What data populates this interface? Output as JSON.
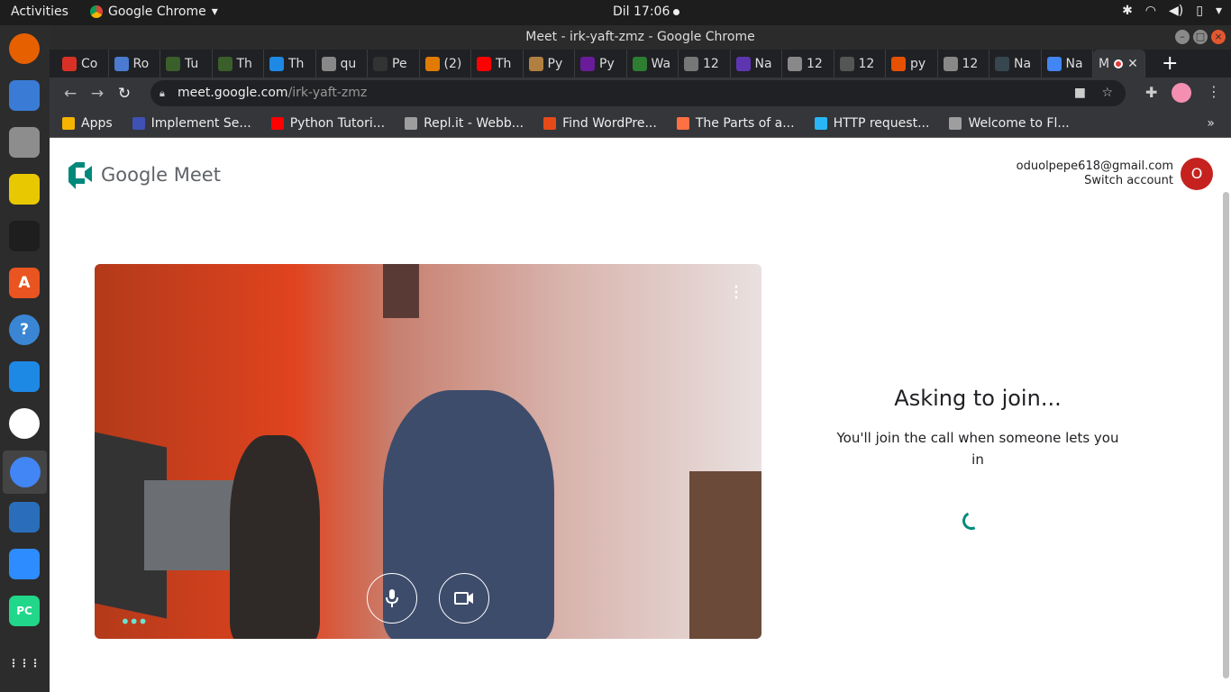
{
  "topbar": {
    "activities": "Activities",
    "app_name": "Google Chrome",
    "clock": "Dil 17:06"
  },
  "window": {
    "title": "Meet - irk-yaft-zmz - Google Chrome"
  },
  "tabs": [
    {
      "label": "Co",
      "color": "#d93025"
    },
    {
      "label": "Ro",
      "color": "#4a7bd0"
    },
    {
      "label": "Tu",
      "color": "#3a5f2a"
    },
    {
      "label": "Th",
      "color": "#3a5f2a"
    },
    {
      "label": "Th",
      "color": "#1e88e5"
    },
    {
      "label": "qu",
      "color": "#888888"
    },
    {
      "label": "Pe",
      "color": "#333333"
    },
    {
      "label": "(2)",
      "color": "#e07b00"
    },
    {
      "label": "Th",
      "color": "#ff0000"
    },
    {
      "label": "Py",
      "color": "#b08040"
    },
    {
      "label": "Py",
      "color": "#6a1b9a"
    },
    {
      "label": "Wa",
      "color": "#2e7d32"
    },
    {
      "label": "12",
      "color": "#777777"
    },
    {
      "label": "Na",
      "color": "#5e35b1"
    },
    {
      "label": "12",
      "color": "#888888"
    },
    {
      "label": "12",
      "color": "#555555"
    },
    {
      "label": "py",
      "color": "#e65100"
    },
    {
      "label": "12",
      "color": "#888888"
    },
    {
      "label": "Na",
      "color": "#37474f"
    },
    {
      "label": "Na",
      "color": "#4285f4"
    }
  ],
  "active_tab": {
    "label": "M"
  },
  "address": {
    "domain": "meet.google.com",
    "path": "/irk-yaft-zmz"
  },
  "bookmarks": [
    {
      "label": "Apps",
      "color": "#f4b400"
    },
    {
      "label": "Implement Se...",
      "color": "#3f51b5"
    },
    {
      "label": "Python Tutori...",
      "color": "#ff0000"
    },
    {
      "label": "Repl.it - Webb...",
      "color": "#9e9e9e"
    },
    {
      "label": "Find WordPre...",
      "color": "#e64a19"
    },
    {
      "label": "The Parts of a...",
      "color": "#ff7043"
    },
    {
      "label": "HTTP request...",
      "color": "#29b6f6"
    },
    {
      "label": "Welcome to Fl...",
      "color": "#9e9e9e"
    }
  ],
  "meet": {
    "logo_text": "Google Meet",
    "email": "oduolpepe618@gmail.com",
    "switch": "Switch account",
    "avatar_letter": "O",
    "asking": "Asking to join...",
    "message": "You'll join the call when someone lets you in"
  },
  "dock": [
    {
      "name": "firefox-icon",
      "color": "#e66000",
      "glyph": ""
    },
    {
      "name": "thunderbird-icon",
      "color": "#3a7bd5",
      "glyph": ""
    },
    {
      "name": "files-icon",
      "color": "#8d8d8d",
      "glyph": ""
    },
    {
      "name": "rhythmbox-icon",
      "color": "#e8c800",
      "glyph": ""
    },
    {
      "name": "figma-icon",
      "color": "#1e1e1e",
      "glyph": ""
    },
    {
      "name": "software-icon",
      "color": "#e95420",
      "glyph": "A"
    },
    {
      "name": "help-icon",
      "color": "#3a86d4",
      "glyph": "?"
    },
    {
      "name": "vscode-icon",
      "color": "#1e88e5",
      "glyph": ""
    },
    {
      "name": "slack-icon",
      "color": "#ffffff",
      "glyph": ""
    },
    {
      "name": "chrome-icon",
      "color": "#4285f4",
      "glyph": ""
    },
    {
      "name": "writer-icon",
      "color": "#2a6ebb",
      "glyph": ""
    },
    {
      "name": "zoom-icon",
      "color": "#2d8cff",
      "glyph": ""
    },
    {
      "name": "pycharm-icon",
      "color": "#21d789",
      "glyph": "PC"
    },
    {
      "name": "app-grid-icon",
      "color": "#2c2c2c",
      "glyph": "⋮⋮⋮"
    }
  ]
}
